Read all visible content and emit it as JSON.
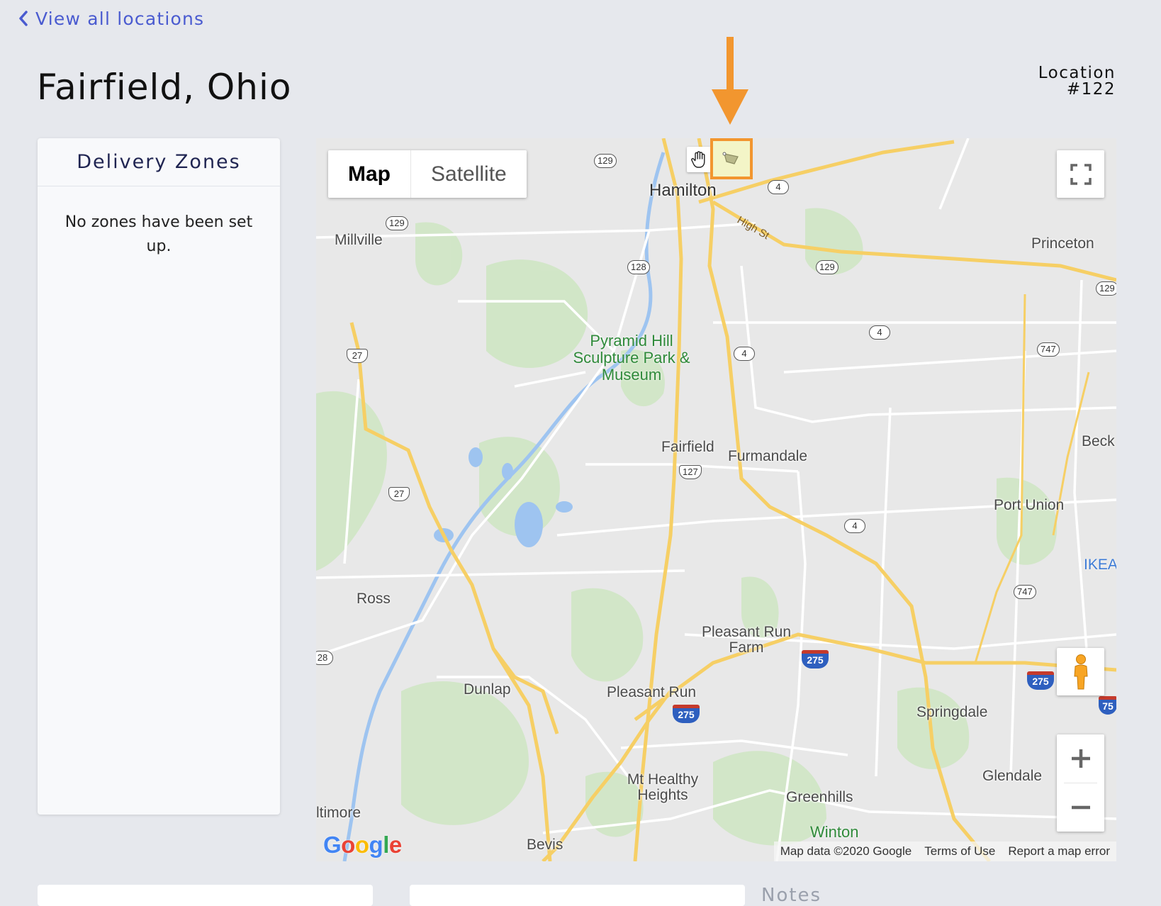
{
  "nav": {
    "back_label": "View all locations"
  },
  "header": {
    "title": "Fairfield, Ohio",
    "location_label": "Location",
    "location_number": "#122"
  },
  "zones": {
    "title": "Delivery Zones",
    "empty_message": "No zones have been set up."
  },
  "map": {
    "type_buttons": {
      "map": "Map",
      "satellite": "Satellite"
    },
    "places": {
      "hamilton": "Hamilton",
      "millville": "Millville",
      "princeton": "Princeton",
      "pyramid_hill": "Pyramid Hill Sculpture Park & Museum",
      "fairfield": "Fairfield",
      "furmandale": "Furmandale",
      "beck": "Beck",
      "port_union": "Port Union",
      "ikea": "IKEA",
      "ross": "Ross",
      "pleasant_run_farm": "Pleasant Run Farm",
      "dunlap": "Dunlap",
      "pleasant_run": "Pleasant Run",
      "springdale": "Springdale",
      "mt_healthy": "Mt Healthy Heights",
      "glendale": "Glendale",
      "greenhills": "Greenhills",
      "winton": "Winton",
      "altimore": "ltimore",
      "bevis": "Bevis"
    },
    "road_names": {
      "high_st": "High St"
    },
    "shields": {
      "r129a": "129",
      "r129b": "129",
      "r129c": "129",
      "r129d": "129",
      "r128": "128",
      "r128b": "28",
      "r4a": "4",
      "r4b": "4",
      "r4c": "4",
      "r4d": "4",
      "r747a": "747",
      "r747b": "747",
      "us27a": "27",
      "us27b": "27",
      "us127": "127",
      "i275a": "275",
      "i275b": "275",
      "i275c": "275",
      "i75": "75"
    },
    "logo": "Google",
    "attribution": {
      "data": "Map data ©2020 Google",
      "terms": "Terms of Use",
      "report": "Report a map error"
    }
  },
  "notes": {
    "heading": "Notes"
  },
  "colors": {
    "accent": "#4a5bd0",
    "highlight": "#f2962f",
    "page_bg": "#e6e8ed"
  },
  "icons": [
    "chevron-left-icon",
    "hand-pan-icon",
    "draw-shape-icon",
    "fullscreen-icon",
    "pegman-icon",
    "zoom-in-icon",
    "zoom-out-icon",
    "down-arrow-annotation"
  ]
}
